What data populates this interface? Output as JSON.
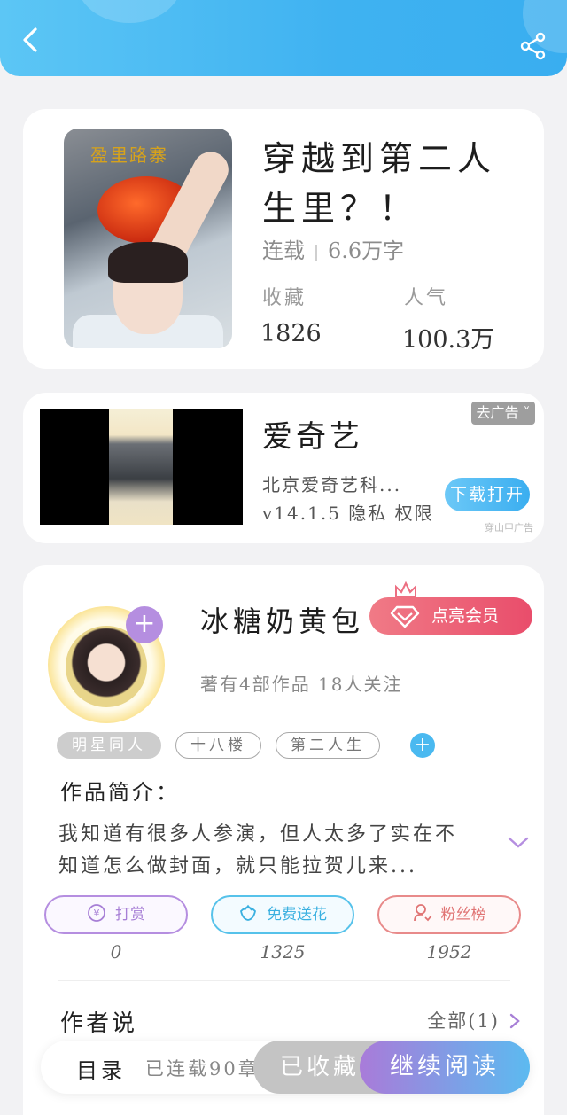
{
  "colors": {
    "header": "#3fb2f1",
    "accent_purple": "#b58ee0",
    "accent_blue": "#4ab9f0",
    "accent_red": "#e94d6b"
  },
  "header": {
    "back_icon": "chevron-left-icon",
    "share_icon": "share-icon"
  },
  "book": {
    "title": "穿越到第二人生里？！",
    "status": "连载",
    "word_count": "6.6万字",
    "favorites_label": "收藏",
    "favorites_value": "1826",
    "popularity_label": "人气",
    "popularity_value": "100.3万",
    "cover_sign": "盈里路寨"
  },
  "ad": {
    "app_name": "爱奇艺",
    "company": "北京爱奇艺科...",
    "meta": "v14.1.5 隐私 权限",
    "close_label": "去广告",
    "download_label": "下载打开",
    "source": "穿山甲广告"
  },
  "author": {
    "name": "冰糖奶黄包",
    "vip_label": "点亮会员",
    "summary": "著有4部作品 18人关注",
    "tags": [
      "明星同人",
      "十八楼",
      "第二人生"
    ],
    "intro_label": "作品简介：",
    "intro_text": "我知道有很多人参演，但人太多了实在不知道怎么做封面，就只能拉贺儿来...",
    "actions": [
      {
        "label": "打赏",
        "count": "0"
      },
      {
        "label": "免费送花",
        "count": "1325"
      },
      {
        "label": "粉丝榜",
        "count": "1952"
      }
    ],
    "says_label": "作者说",
    "says_all": "全部(1)"
  },
  "bottom": {
    "toc": "目录",
    "serial_status": "已连载90章",
    "collected": "已收藏",
    "continue": "继续阅读"
  }
}
